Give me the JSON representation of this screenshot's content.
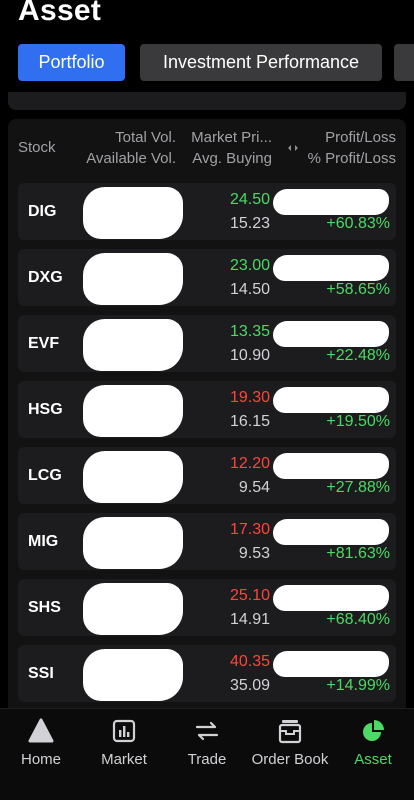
{
  "page": {
    "title": "Asset"
  },
  "tabs": [
    {
      "label": "Portfolio",
      "active": true
    },
    {
      "label": "Investment Performance",
      "active": false
    }
  ],
  "columns": {
    "stock": "Stock",
    "total_vol": "Total Vol.",
    "available_vol": "Available Vol.",
    "market_price": "Market Pri...",
    "avg_buying": "Avg. Buying",
    "profit_loss": "Profit/Loss",
    "pct_profit_loss": "% Profit/Loss"
  },
  "holdings": [
    {
      "ticker": "DIG",
      "market_price": "24.50",
      "avg_buying": "15.23",
      "pct": "+60.83%",
      "price_trend": "up"
    },
    {
      "ticker": "DXG",
      "market_price": "23.00",
      "avg_buying": "14.50",
      "pct": "+58.65%",
      "price_trend": "up"
    },
    {
      "ticker": "EVF",
      "market_price": "13.35",
      "avg_buying": "10.90",
      "pct": "+22.48%",
      "price_trend": "up"
    },
    {
      "ticker": "HSG",
      "market_price": "19.30",
      "avg_buying": "16.15",
      "pct": "+19.50%",
      "price_trend": "down"
    },
    {
      "ticker": "LCG",
      "market_price": "12.20",
      "avg_buying": "9.54",
      "pct": "+27.88%",
      "price_trend": "down"
    },
    {
      "ticker": "MIG",
      "market_price": "17.30",
      "avg_buying": "9.53",
      "pct": "+81.63%",
      "price_trend": "down"
    },
    {
      "ticker": "SHS",
      "market_price": "25.10",
      "avg_buying": "14.91",
      "pct": "+68.40%",
      "price_trend": "down"
    },
    {
      "ticker": "SSI",
      "market_price": "40.35",
      "avg_buying": "35.09",
      "pct": "+14.99%",
      "price_trend": "down"
    }
  ],
  "nav": [
    {
      "label": "Home",
      "icon": "home-icon",
      "active": false
    },
    {
      "label": "Market",
      "icon": "market-chart-icon",
      "active": false
    },
    {
      "label": "Trade",
      "icon": "trade-arrows-icon",
      "active": false
    },
    {
      "label": "Order Book",
      "icon": "order-book-icon",
      "active": false
    },
    {
      "label": "Asset",
      "icon": "asset-pie-icon",
      "active": true
    }
  ],
  "colors": {
    "accent": "#2f6ff0",
    "up": "#4cd964",
    "down": "#ff453a"
  }
}
